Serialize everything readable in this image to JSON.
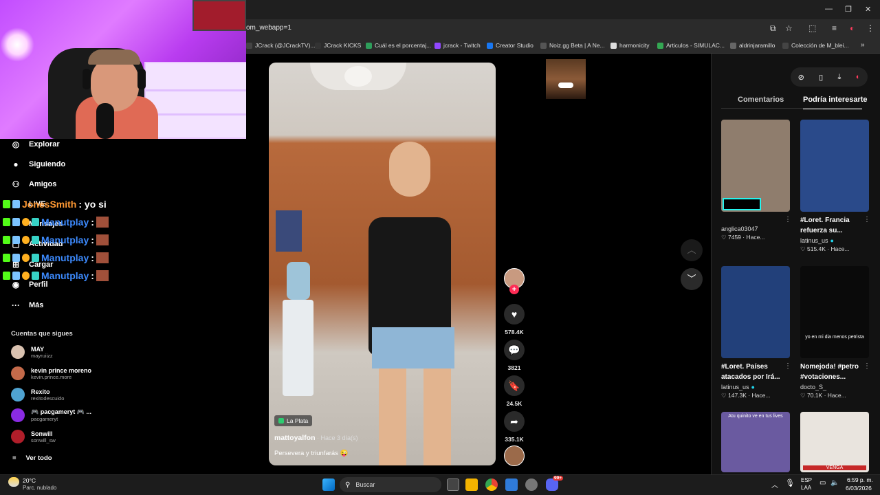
{
  "browser": {
    "url_fragment": "om_webapp=1",
    "window_controls": [
      "—",
      "❐",
      "✕"
    ],
    "bookmarks": [
      {
        "label": "JCrack (@JCrackTV)...",
        "color": "#444444"
      },
      {
        "label": "JCrack KICKS",
        "color": "#333333"
      },
      {
        "label": "Cuál es el porcentaj...",
        "color": "#2e9e5b"
      },
      {
        "label": "jcrack - Twitch",
        "color": "#9147ff"
      },
      {
        "label": "Creator Studio",
        "color": "#1877f2"
      },
      {
        "label": "Noiz.gg Beta | A Ne...",
        "color": "#555555"
      },
      {
        "label": "harmonicity",
        "color": "#dddddd"
      },
      {
        "label": "Articulos - SIMULAC...",
        "color": "#34a853"
      },
      {
        "label": "aldrinjaramillo",
        "color": "#666666"
      },
      {
        "label": "Colección de M_blei...",
        "color": "#444444"
      }
    ],
    "more_bookmarks": "»"
  },
  "sidebar": {
    "nav": [
      {
        "label": "Explorar",
        "icon": "compass-icon",
        "glyph": "◎"
      },
      {
        "label": "Siguiendo",
        "icon": "following-avatar-icon",
        "glyph": "●"
      },
      {
        "label": "Amigos",
        "icon": "friends-icon",
        "glyph": "⚇"
      },
      {
        "label": "LIVE",
        "icon": "live-icon",
        "glyph": "▣"
      },
      {
        "label": "Mensajes",
        "icon": "messages-icon",
        "glyph": "✉"
      },
      {
        "label": "Actividad",
        "icon": "activity-icon",
        "glyph": "▢"
      },
      {
        "label": "Cargar",
        "icon": "upload-icon",
        "glyph": "⊞"
      },
      {
        "label": "Perfil",
        "icon": "profile-icon",
        "glyph": "◉"
      },
      {
        "label": "Más",
        "icon": "more-icon",
        "glyph": "···"
      }
    ],
    "following_title": "Cuentas que sigues",
    "accounts": [
      {
        "name": "MAY",
        "handle": "mayruiizz",
        "color": "#d9c2b0"
      },
      {
        "name": "kevin prince moreno",
        "handle": "kevin.prince.more",
        "color": "#c46a4a"
      },
      {
        "name": "Rexito",
        "handle": "rexitodescuido",
        "color": "#4fa3d1"
      },
      {
        "name": "🎮 pacgameryt 🎮 ...",
        "handle": "pacgameryt",
        "color": "#8a2be2"
      },
      {
        "name": "Sonwill",
        "handle": "sonwill_sw",
        "color": "#b01e2a"
      }
    ],
    "see_all": "Ver todo"
  },
  "chat": [
    {
      "user": "JonesSmith",
      "message": ": yo si",
      "user_color": "#ff9933"
    },
    {
      "user": "Manutplay",
      "message": ":",
      "user_color": "#3d8bff"
    },
    {
      "user": "Manutplay",
      "message": ":",
      "user_color": "#3d8bff"
    },
    {
      "user": "Manutplay",
      "message": ":",
      "user_color": "#3d8bff"
    },
    {
      "user": "Manutplay",
      "message": ":",
      "user_color": "#3d8bff"
    }
  ],
  "video": {
    "location": "La Plata",
    "author": "mattoyalfon",
    "time": " · Hace 3 día(s)",
    "caption": "Persevera y triunfarás 😜",
    "actions": [
      {
        "name": "like",
        "icon": "heart-icon",
        "glyph": "♥",
        "count": "578.4K"
      },
      {
        "name": "comment",
        "icon": "comment-icon",
        "glyph": "💬",
        "count": "3821"
      },
      {
        "name": "save",
        "icon": "bookmark-icon",
        "glyph": "🔖",
        "count": "24.5K"
      },
      {
        "name": "share",
        "icon": "share-icon",
        "glyph": "➦",
        "count": "335.1K"
      }
    ]
  },
  "right_panel": {
    "tabs": [
      "Comentarios",
      "Podría interesarte"
    ],
    "active_tab": 1,
    "cards": [
      {
        "title": "",
        "author": "anglica03047",
        "likes": "7459",
        "time": "Hace...",
        "thumb": "#8f7d6d",
        "verified": false
      },
      {
        "title": "#Loret. Francia refuerza su...",
        "author": "latinus_us",
        "likes": "515.4K",
        "time": "Hace...",
        "thumb": "#2a4a8a",
        "verified": true
      },
      {
        "title": "#Loret. Países atacados por Irá...",
        "author": "latinus_us",
        "likes": "147.3K",
        "time": "Hace...",
        "thumb": "#22407a",
        "verified": true
      },
      {
        "title": "Nomejoda! #petro #votaciones...",
        "author": "docto_S_",
        "likes": "70.1K",
        "time": "Hace...",
        "thumb": "#0a0a0a",
        "verified": false,
        "overlay_text": "yo en mi dia menos petrista"
      },
      {
        "title": "",
        "author": "",
        "likes": "",
        "time": "",
        "thumb": "#6a5aa0",
        "verified": false,
        "overlay_text": "Atu quinito ve en tus lives"
      },
      {
        "title": "",
        "author": "",
        "likes": "",
        "time": "",
        "thumb": "#e9e4de",
        "verified": false,
        "overlay_text": "VENGA"
      }
    ]
  },
  "taskbar": {
    "weather_temp": "20°C",
    "weather_desc": "Parc. nublado",
    "search_placeholder": "Buscar",
    "lang": "ESP",
    "lang2": "LAA",
    "time": "6:59 p. m.",
    "date": "6/03/2026",
    "notif_badge": "99+"
  }
}
